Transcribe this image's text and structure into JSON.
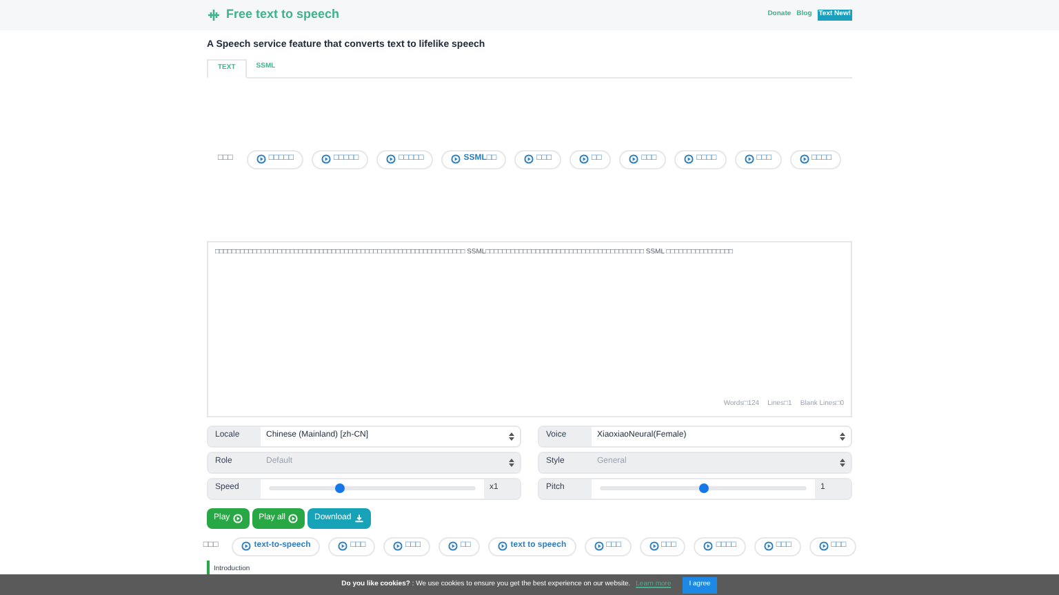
{
  "header": {
    "brand": "Free text to speech",
    "links": [
      {
        "label": "Donate",
        "kind": "link"
      },
      {
        "label": "Blog",
        "kind": "link"
      },
      {
        "label": "Text New!",
        "kind": "highlight"
      }
    ]
  },
  "subtitle": "A Speech service feature that converts text to lifelike speech",
  "tabs": [
    {
      "label": "TEXT",
      "selected": true
    },
    {
      "label": "SSML",
      "selected": false
    }
  ],
  "tag_row_1": {
    "label": "□□□",
    "tags": [
      "□□□□□",
      "□□□□□",
      "□□□□□",
      "SSML□□",
      "□□□",
      "□□",
      "□□□",
      "□□□□",
      "□□□",
      "□□□□"
    ]
  },
  "editor": {
    "value": "□□□□□□□□□□□□□□□□□□□□□□□□□□□□□□□□□□□□□□□□□□□□□□□□□□□□□□□□□□□□ SSML□□□□□□□□□□□□□□□□□□□□□□□□□□□□□□□□□□□□□□ SSML □□□□□□□□□□□□□□□□",
    "stats": [
      "Words□124",
      "Lines□1",
      "Blank Lines□0"
    ]
  },
  "fields": [
    {
      "kind": "select",
      "label": "Locale",
      "value": "Chinese (Mainland) [zh-CN]",
      "disabled": false
    },
    {
      "kind": "select",
      "label": "Voice",
      "value": "XiaoxiaoNeural(Female)",
      "disabled": false
    },
    {
      "kind": "select",
      "label": "Role",
      "value": "Default",
      "disabled": true
    },
    {
      "kind": "select",
      "label": "Style",
      "value": "General",
      "disabled": true
    },
    {
      "kind": "slider",
      "label": "Speed",
      "level": 0.34,
      "reading": "x1"
    },
    {
      "kind": "slider",
      "label": "Pitch",
      "level": 0.5,
      "reading": "1"
    }
  ],
  "buttons": [
    {
      "label": "Play",
      "kind": "play"
    },
    {
      "label": "Play all",
      "kind": "play"
    },
    {
      "label": "Download",
      "kind": "download"
    }
  ],
  "tag_row_2": {
    "label": "□□□",
    "tags": [
      "text-to-speech",
      "□□□",
      "□□□",
      "□□",
      "text to speech",
      "□□□",
      "□□□",
      "□□□□",
      "□□□",
      "□□□"
    ]
  },
  "intro": {
    "heading": "Introduction"
  },
  "cookie_bar": {
    "title": "Do you like cookies?",
    "text": ": We use cookies to ensure you get the best experience on our website.",
    "link": "Learn more",
    "button": "I agree"
  }
}
